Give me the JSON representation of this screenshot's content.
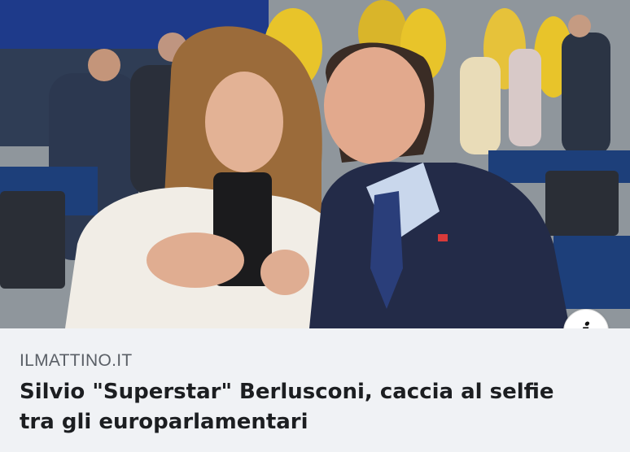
{
  "link_preview": {
    "source": "ILMATTINO.IT",
    "headline": "Silvio \"Superstar\" Berlusconi, caccia al selfie tra gli europarlamentari",
    "info_icon": "info-icon",
    "info_glyph": "i"
  },
  "colors": {
    "caption_background": "#f0f2f5",
    "source_text": "#5a5f66",
    "headline_text": "#1c1e21",
    "accent_yellow": "#e8c42a"
  }
}
